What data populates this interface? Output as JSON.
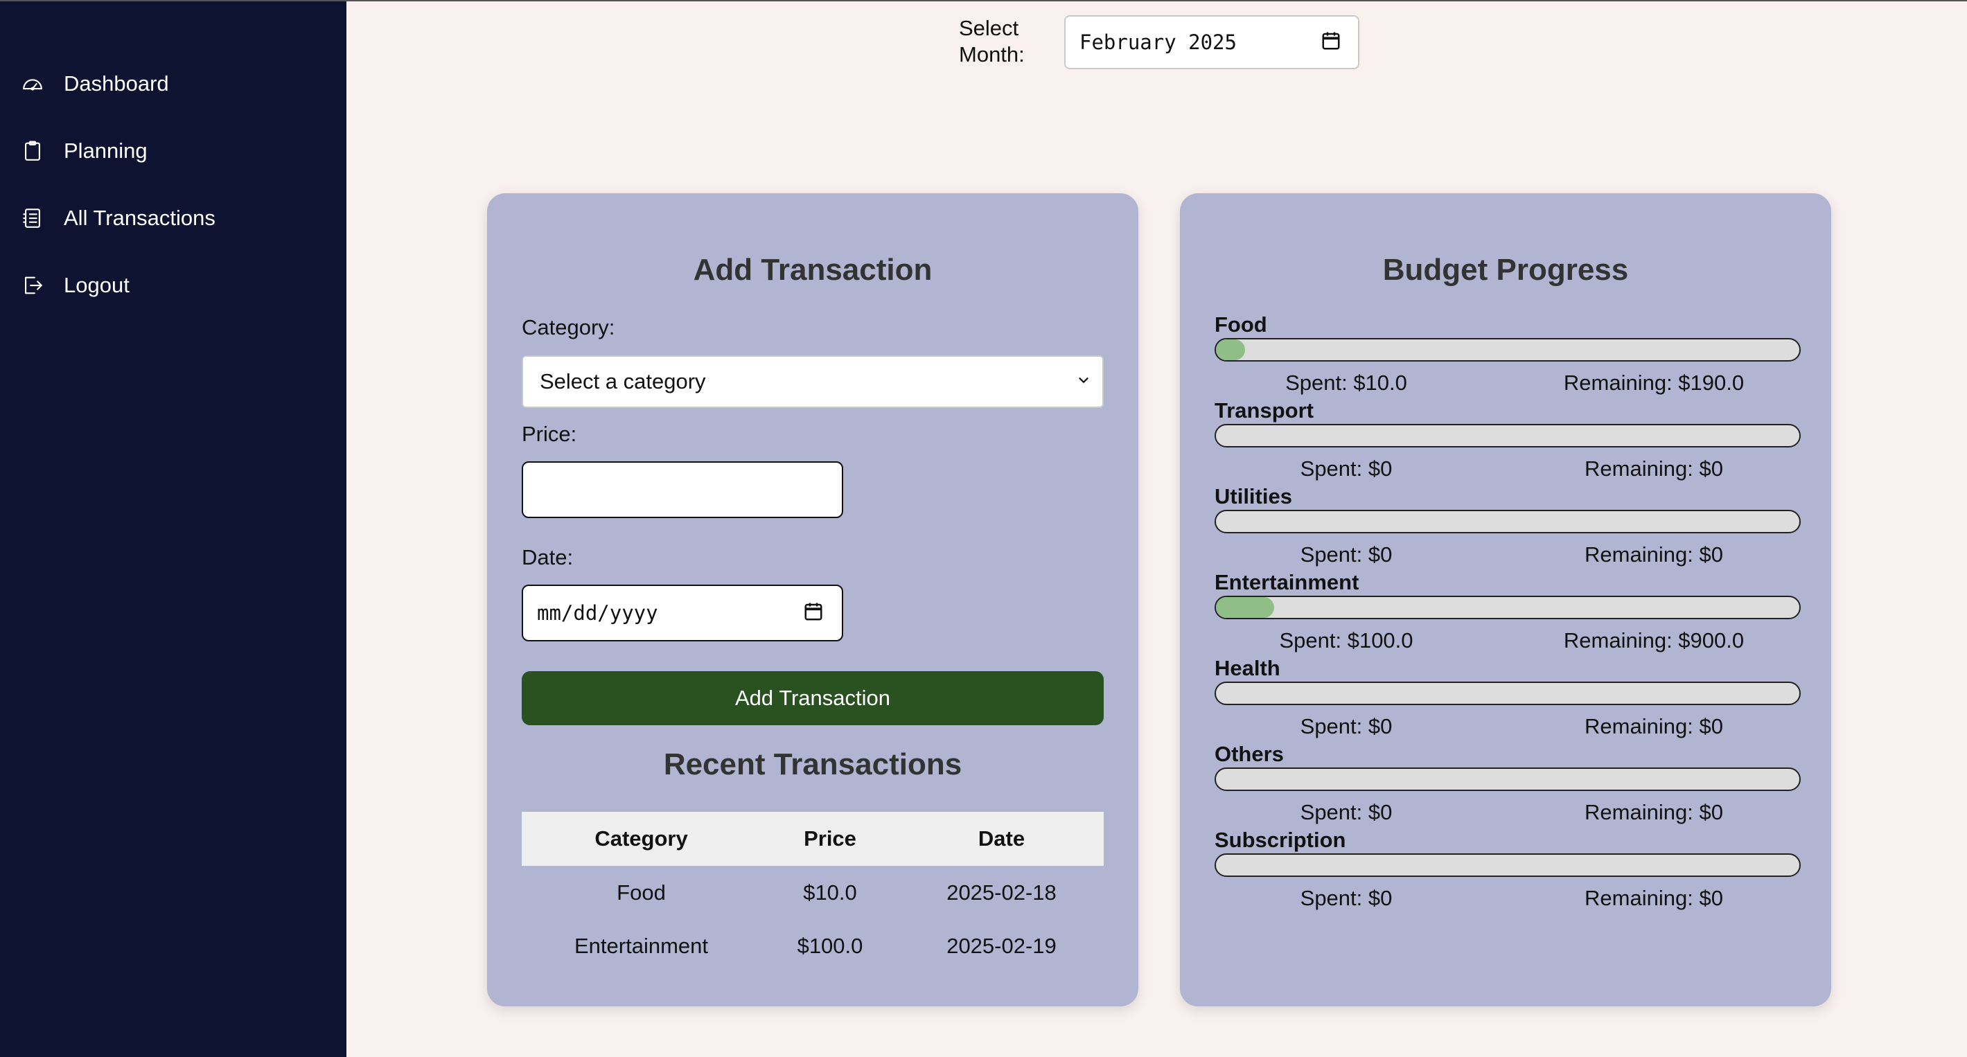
{
  "sidebar": {
    "items": [
      {
        "label": "Dashboard",
        "icon": "gauge-icon"
      },
      {
        "label": "Planning",
        "icon": "clipboard-icon"
      },
      {
        "label": "All Transactions",
        "icon": "receipt-list-icon"
      },
      {
        "label": "Logout",
        "icon": "logout-icon"
      }
    ]
  },
  "month_selector": {
    "label": "Select Month:",
    "value": "February 2025"
  },
  "add_transaction": {
    "title": "Add Transaction",
    "category_label": "Category:",
    "category_value": "Select a category",
    "price_label": "Price:",
    "price_value": "",
    "date_label": "Date:",
    "date_placeholder": "mm/dd/yyyy",
    "button_label": "Add Transaction"
  },
  "recent_transactions": {
    "title": "Recent Transactions",
    "columns": [
      "Category",
      "Price",
      "Date"
    ],
    "rows": [
      [
        "Food",
        "$10.0",
        "2025-02-18"
      ],
      [
        "Entertainment",
        "$100.0",
        "2025-02-19"
      ]
    ]
  },
  "budget_progress": {
    "title": "Budget Progress",
    "categories": [
      {
        "name": "Food",
        "spent": "Spent: $10.0",
        "remaining": "Remaining: $190.0",
        "progress": 0.05
      },
      {
        "name": "Transport",
        "spent": "Spent: $0",
        "remaining": "Remaining: $0",
        "progress": 0
      },
      {
        "name": "Utilities",
        "spent": "Spent: $0",
        "remaining": "Remaining: $0",
        "progress": 0
      },
      {
        "name": "Entertainment",
        "spent": "Spent: $100.0",
        "remaining": "Remaining: $900.0",
        "progress": 0.1
      },
      {
        "name": "Health",
        "spent": "Spent: $0",
        "remaining": "Remaining: $0",
        "progress": 0
      },
      {
        "name": "Others",
        "spent": "Spent: $0",
        "remaining": "Remaining: $0",
        "progress": 0
      },
      {
        "name": "Subscription",
        "spent": "Spent: $0",
        "remaining": "Remaining: $0",
        "progress": 0
      }
    ]
  },
  "colors": {
    "sidebar_bg": "#0d1330",
    "page_bg": "#f9f1ef",
    "card_bg": "#b1b5d1",
    "button_bg": "#2a5221",
    "progress_fill": "#8fbf86"
  }
}
